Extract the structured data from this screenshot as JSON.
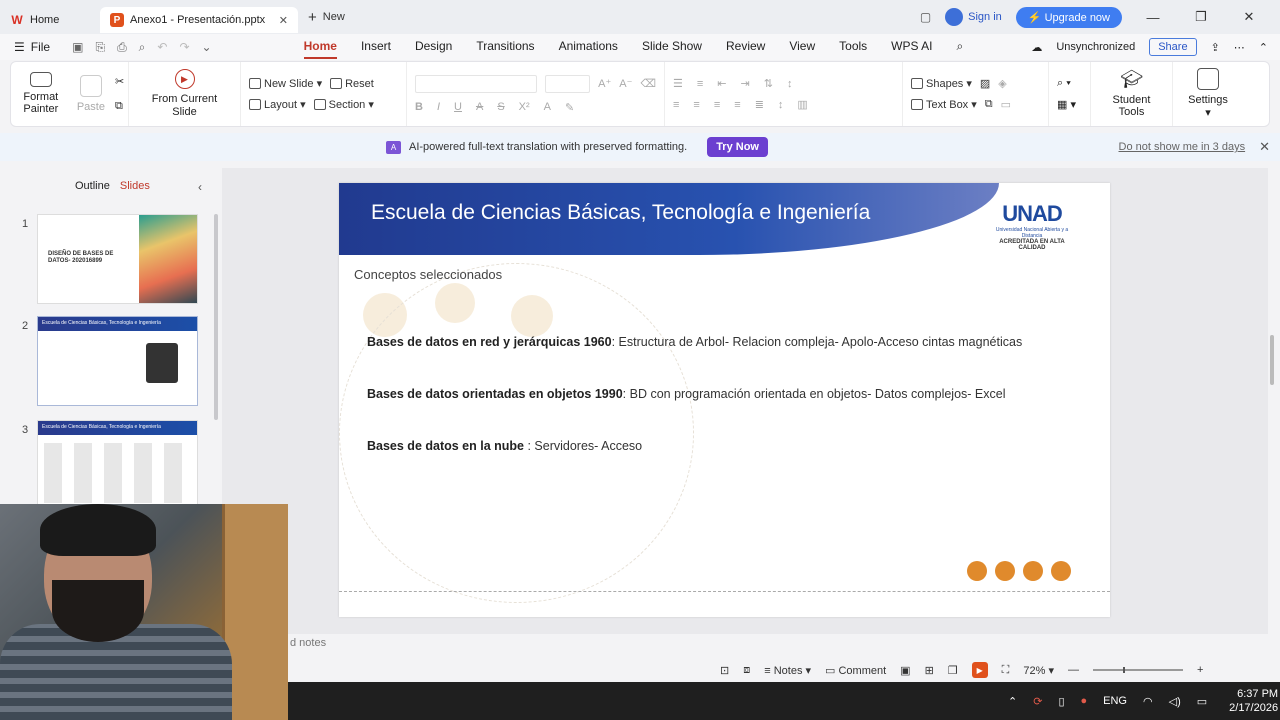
{
  "titlebar": {
    "home_tab": "Home",
    "doc_tab": "Anexo1 - Presentación.pptx",
    "new_tab": "New",
    "sign_in": "Sign in",
    "upgrade": "Upgrade now"
  },
  "menubar": {
    "file": "File",
    "menus": [
      "Home",
      "Insert",
      "Design",
      "Transitions",
      "Animations",
      "Slide Show",
      "Review",
      "View",
      "Tools",
      "WPS AI"
    ],
    "unsynchronized": "Unsynchronized",
    "share": "Share"
  },
  "ribbon": {
    "format_painter": "Format Painter",
    "paste": "Paste",
    "from_current_slide": "From Current Slide",
    "new_slide": "New Slide",
    "layout": "Layout",
    "reset": "Reset",
    "section": "Section",
    "shapes": "Shapes",
    "text_box": "Text Box",
    "student_tools": "Student Tools",
    "settings": "Settings"
  },
  "banner": {
    "text": "AI-powered full-text translation with preserved formatting.",
    "try_now": "Try Now",
    "dont_show": "Do not show me in 3 days"
  },
  "leftpane": {
    "outline": "Outline",
    "slides": "Slides",
    "thumbs": [
      {
        "num": "1",
        "title": "DISEÑO DE BASES DE DATOS- 202016899"
      },
      {
        "num": "2",
        "title": "Escuela de Ciencias Básicas, Tecnología e Ingeniería"
      },
      {
        "num": "3",
        "title": "Escuela de Ciencias Básicas, Tecnología e Ingeniería"
      }
    ]
  },
  "slide": {
    "title": "Escuela de Ciencias Básicas, Tecnología e Ingeniería",
    "logo_main": "UNAD",
    "logo_sub": "Universidad Nacional Abierta y a Distancia",
    "logo_acc": "ACREDITADA EN ALTA CALIDAD",
    "subtitle": "Conceptos seleccionados",
    "points": [
      {
        "bold": "Bases de datos en red y jerárquicas 1960",
        "rest": ": Estructura de Arbol- Relacion compleja- Apolo-Acceso cintas magnéticas"
      },
      {
        "bold": "Bases de datos orientadas en objetos 1990",
        "rest": ": BD con programación orientada en objetos- Datos complejos- Excel"
      },
      {
        "bold": "Bases de datos en la nube",
        "rest": " : Servidores- Acceso"
      }
    ]
  },
  "notes": "d notes",
  "statusbar": {
    "notes": "Notes",
    "comment": "Comment",
    "zoom": "72%"
  },
  "taskbar": {
    "lang": "ENG",
    "time": "6:37 PM",
    "date": "2/17/2026"
  }
}
